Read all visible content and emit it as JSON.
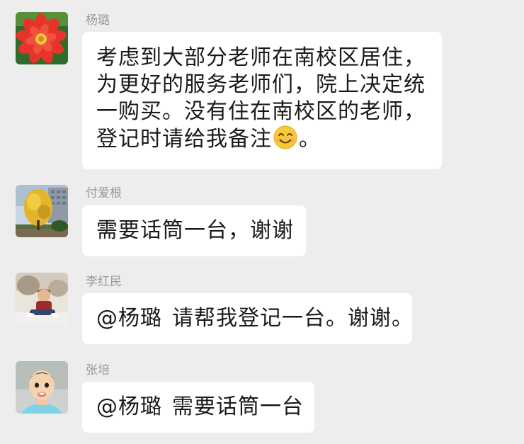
{
  "messages": [
    {
      "sender": "杨璐",
      "avatar_icon": "red-flower-avatar",
      "lines": [
        "考虑到大部分老师在南校区居住，",
        "为更好的服务老师们，院上决定统",
        "一购买。没有住在南校区的老师，",
        "登记时请给我备注"
      ],
      "emoji": "smiling-face-emoji",
      "end_punct": "。"
    },
    {
      "sender": "付爱根",
      "avatar_icon": "ginkgo-tree-avatar",
      "text": "需要话筒一台，谢谢"
    },
    {
      "sender": "李红民",
      "avatar_icon": "child-sitting-avatar",
      "mention": "@杨璐",
      "text": "请帮我登记一台。谢谢。"
    },
    {
      "sender": "张培",
      "avatar_icon": "baby-portrait-avatar",
      "mention": "@杨璐",
      "text": "需要话筒一台"
    }
  ],
  "colors": {
    "background": "#ededed",
    "bubble": "#ffffff",
    "sender_name": "#9b9b9b",
    "text": "#1a1a1a"
  }
}
